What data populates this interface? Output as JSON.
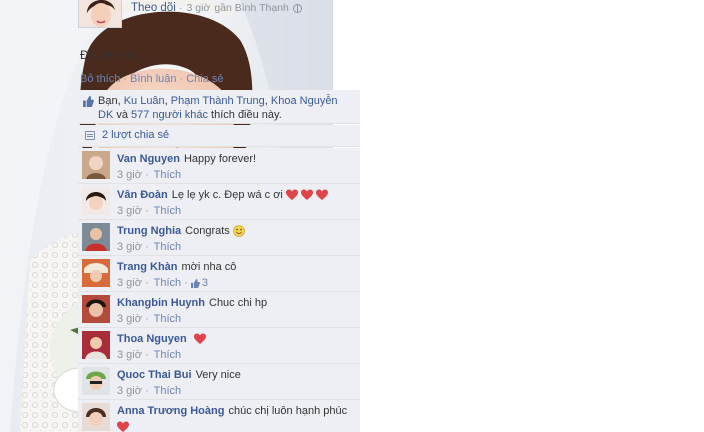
{
  "header": {
    "follow_label": "Theo dõi",
    "time": "3 giờ",
    "location": "gần Bình Thạnh"
  },
  "post": {
    "text": "Đã đến lúc ,,,,,"
  },
  "actions": {
    "like": "Bỏ thích",
    "comment": "Bình luận",
    "share": "Chia sẻ"
  },
  "likes": {
    "prefix": "Bạn, ",
    "name1": "Ku Luân",
    "sep1": ", ",
    "name2": "Phạm Thành Trung",
    "sep2": ", ",
    "name3": "Khoa Nguyễn DK",
    "mid": " và ",
    "others": "577 người khác",
    "suffix": " thích điều này."
  },
  "shares": {
    "label": "2 lượt chia sẻ"
  },
  "comments": [
    {
      "name": "Van Nguyen",
      "text": "Happy forever!",
      "time": "3 giờ",
      "like": "Thích",
      "hearts": 0,
      "smile": false,
      "likes": ""
    },
    {
      "name": "Vân Đoàn",
      "text": "Lẹ lẹ yk c. Đẹp wá c ơi",
      "time": "3 giờ",
      "like": "Thích",
      "hearts": 3,
      "smile": false,
      "likes": ""
    },
    {
      "name": "Trung Nghia",
      "text": "Congrats",
      "time": "3 giờ",
      "like": "Thích",
      "hearts": 0,
      "smile": true,
      "likes": ""
    },
    {
      "name": "Trang Khàn",
      "text": "mời nha cô",
      "time": "3 giờ",
      "like": "Thích",
      "hearts": 0,
      "smile": false,
      "likes": "3"
    },
    {
      "name": "Khangbin Huynh",
      "text": "Chuc chi hp",
      "time": "3 giờ",
      "like": "Thích",
      "hearts": 0,
      "smile": false,
      "likes": ""
    },
    {
      "name": "Thoa Nguyen",
      "text": "",
      "time": "3 giờ",
      "like": "Thích",
      "hearts": 1,
      "smile": false,
      "likes": ""
    },
    {
      "name": "Quoc Thai Bui",
      "text": "Very nice",
      "time": "3 giờ",
      "like": "Thích",
      "hearts": 0,
      "smile": false,
      "likes": ""
    },
    {
      "name": "Anna Trương Hoàng",
      "text": "chúc chị luôn hạnh phúc",
      "time": "",
      "like": "",
      "hearts": 1,
      "smile": false,
      "likes": ""
    }
  ],
  "icons": {
    "globe": "globe-icon",
    "like": "thumbs-up-icon",
    "share": "share-icon",
    "heart": "heart-icon",
    "smile": "smiley-icon"
  },
  "colors": {
    "link": "#3b5998",
    "meta": "#90949c",
    "panel": "#edeff4",
    "heart": "#e0454b"
  }
}
